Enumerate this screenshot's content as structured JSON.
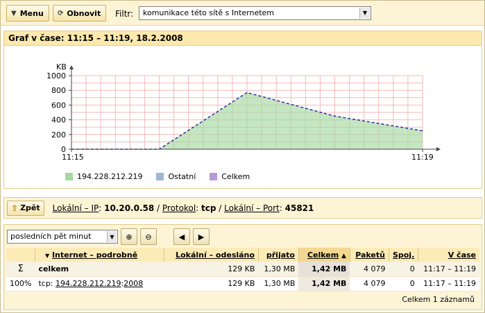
{
  "toolbar": {
    "menu_label": "Menu",
    "refresh_label": "Obnovit",
    "filter_label": "Filtr:",
    "filter_value": "komunikace této sítě s Internetem"
  },
  "graph": {
    "title": "Graf v čase: 11:15 – 11:19, 18.2.2008",
    "legend": [
      {
        "label": "194.228.212.219",
        "color": "#a6d8a2"
      },
      {
        "label": "Ostatní",
        "color": "#9fb7d6"
      },
      {
        "label": "Celkem",
        "color": "#b89ad8"
      }
    ]
  },
  "chart_data": {
    "type": "area",
    "title": "",
    "xlabel": "",
    "ylabel": "KB",
    "x": [
      "11:15",
      "11:16",
      "11:17",
      "11:18",
      "11:19"
    ],
    "x_tick_labels": [
      "11:15",
      "11:19"
    ],
    "ylim": [
      0,
      1000
    ],
    "y_ticks": [
      0,
      200,
      400,
      600,
      800,
      1000
    ],
    "grid": true,
    "series": [
      {
        "name": "194.228.212.219",
        "values": [
          0,
          0,
          770,
          450,
          250
        ],
        "color": "#a6d8a2",
        "line_color": "#2b2b9a"
      }
    ]
  },
  "connection": {
    "back_label": "Zpět",
    "local_ip_label": "Lokální – IP",
    "local_ip_value": "10.20.0.58",
    "protocol_label": "Protokol",
    "protocol_value": "tcp",
    "local_port_label": "Lokální – Port",
    "local_port_value": "45821"
  },
  "table": {
    "time_select": "posledních pět minut",
    "columns": [
      "Internet – podrobně",
      "Lokální – odesláno",
      "přijato",
      "Celkem",
      "Paketů",
      "Spoj.",
      "V čase"
    ],
    "total_row": {
      "sigma": "Σ",
      "label": "celkem",
      "sent": "129 KB",
      "received": "1,30 MB",
      "total": "1,42 MB",
      "packets": "4 079",
      "connections": "0",
      "time": "11:17 – 11:19"
    },
    "rows": [
      {
        "percent": "100%",
        "proto": "tcp:",
        "host": "194.228.212.219",
        "sep": ":",
        "port": "2008",
        "sent": "129 KB",
        "received": "1,30 MB",
        "total": "1,42 MB",
        "packets": "4 079",
        "connections": "0",
        "time": "11:17 – 11:19"
      }
    ],
    "footer": "Celkem 1 záznamů"
  }
}
